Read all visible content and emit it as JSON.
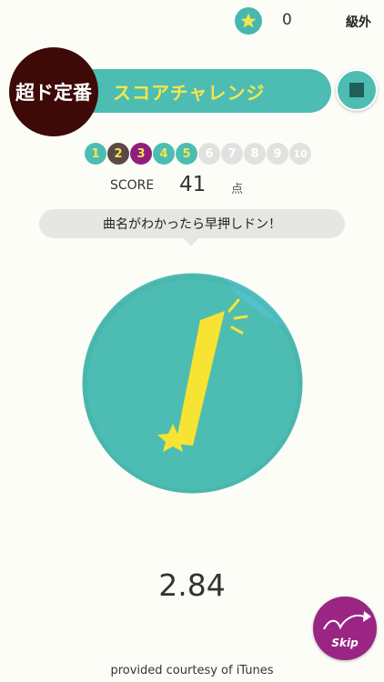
{
  "status": {
    "star_count": "0",
    "rank": "級外"
  },
  "header": {
    "logo_text": "超ド定番",
    "title": "スコアチャレンジ"
  },
  "progress": {
    "questions": [
      {
        "num": "1",
        "bg": "#4dbdb3",
        "fg": "#f4e64a"
      },
      {
        "num": "2",
        "bg": "#5a4a45",
        "fg": "#f4e64a"
      },
      {
        "num": "3",
        "bg": "#8e1f7d",
        "fg": "#f4e64a"
      },
      {
        "num": "4",
        "bg": "#4dbdb3",
        "fg": "#f4e64a"
      },
      {
        "num": "5",
        "bg": "#4dbdb3",
        "fg": "#f4e64a"
      },
      {
        "num": "6",
        "bg": "#e1e1df",
        "fg": "#ffffff"
      },
      {
        "num": "7",
        "bg": "#e1e1df",
        "fg": "#ffffff"
      },
      {
        "num": "8",
        "bg": "#e1e1df",
        "fg": "#ffffff"
      },
      {
        "num": "9",
        "bg": "#e1e1df",
        "fg": "#ffffff"
      },
      {
        "num": "10",
        "bg": "#e1e1df",
        "fg": "#ffffff"
      }
    ]
  },
  "score": {
    "label": "SCORE",
    "value": "41",
    "unit": "点"
  },
  "prompt": {
    "text": "曲名がわかったら早押しドン！"
  },
  "buzzer": {
    "icon": "exclamation-star-icon",
    "color": "#4dbdb3"
  },
  "timer": {
    "value": "2.84"
  },
  "skip": {
    "label": "Skip",
    "color": "#9a2583"
  },
  "footer": {
    "credit": "provided courtesy of iTunes"
  }
}
